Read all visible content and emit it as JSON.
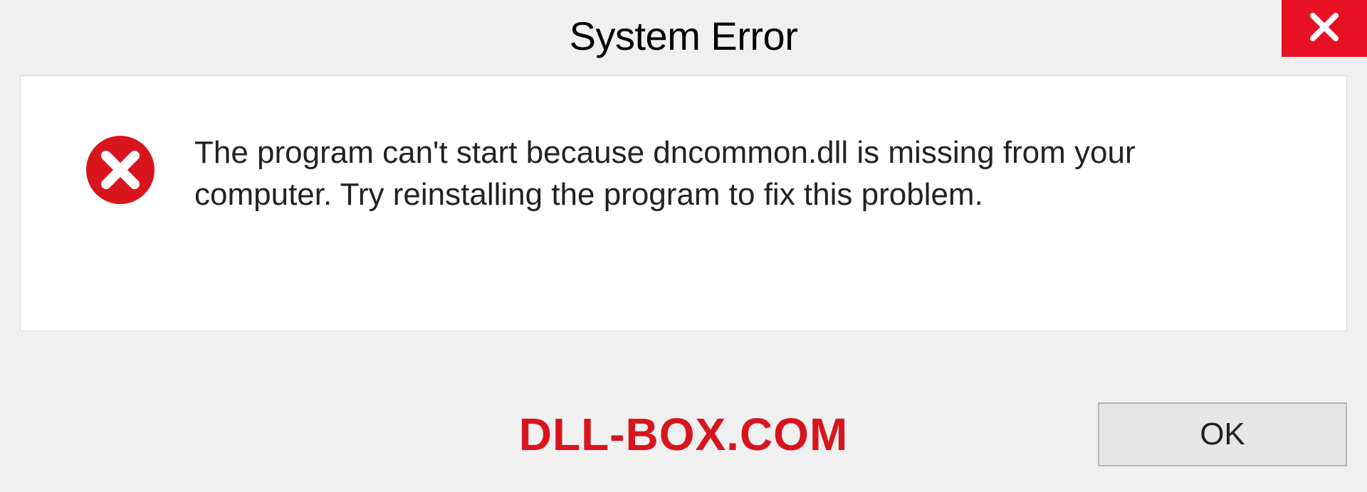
{
  "dialog": {
    "title": "System Error",
    "message": "The program can't start because dncommon.dll is missing from your computer. Try reinstalling the program to fix this problem.",
    "ok_label": "OK"
  },
  "watermark": "DLL-BOX.COM",
  "colors": {
    "close_bg": "#e81123",
    "error_icon": "#d8141c",
    "watermark": "#d8141c"
  }
}
